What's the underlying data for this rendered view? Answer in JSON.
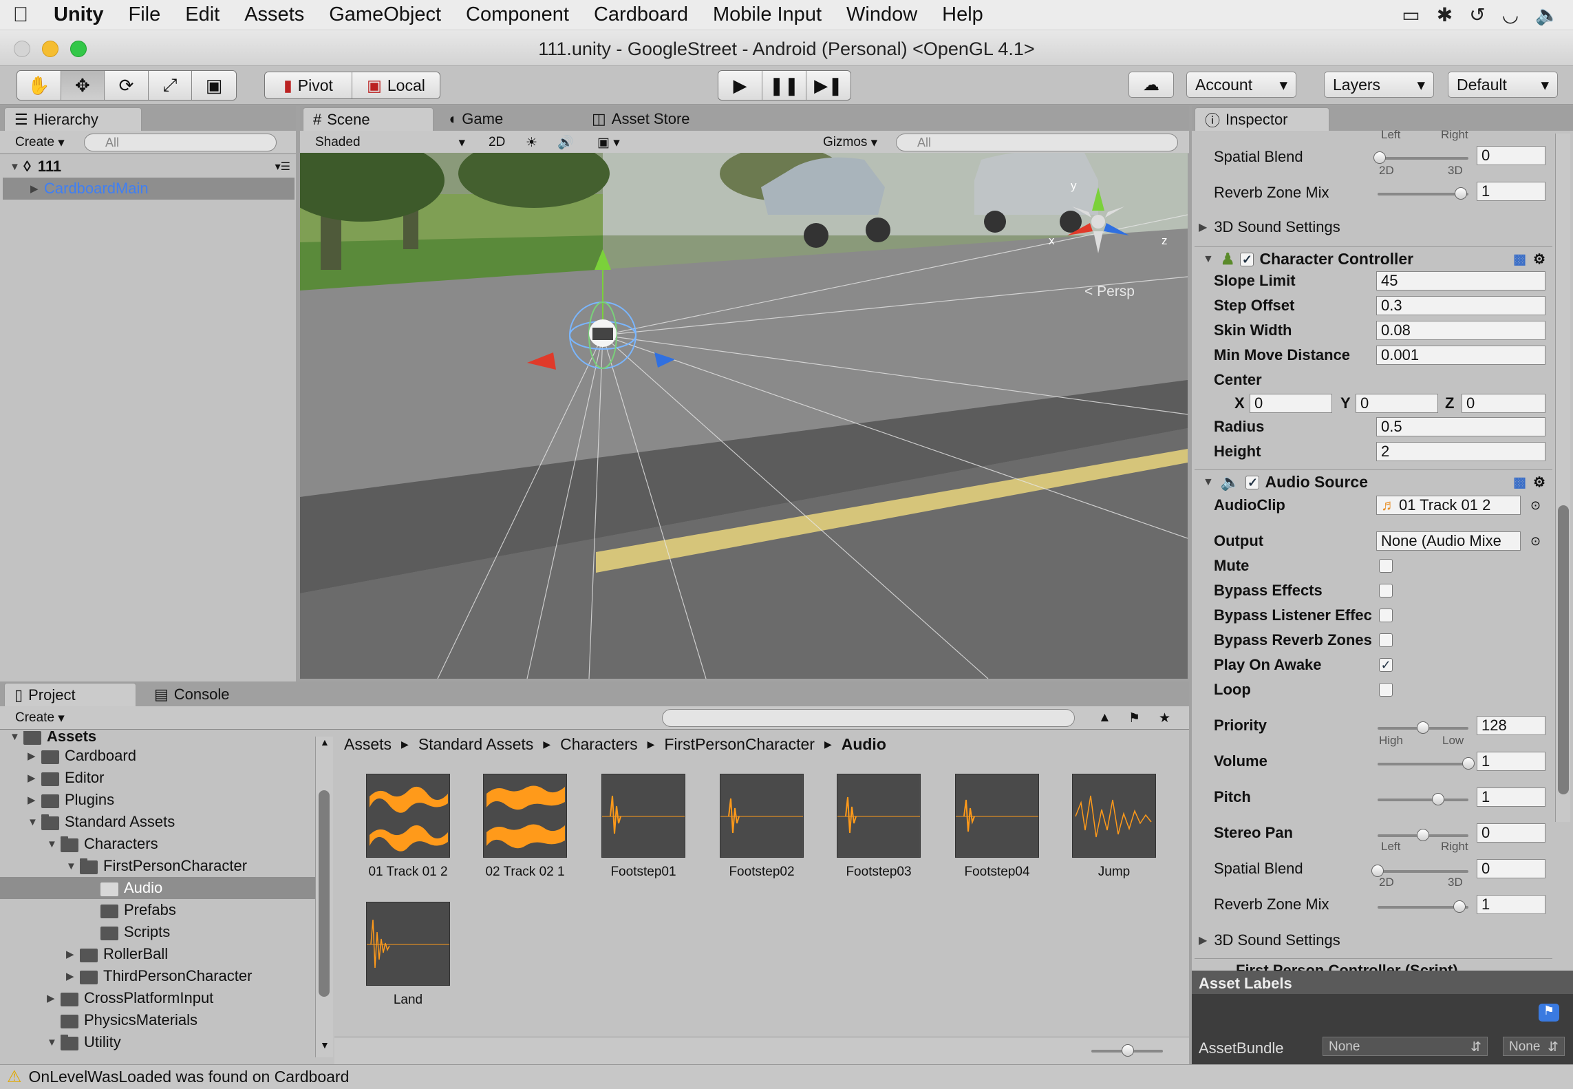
{
  "menubar": {
    "app": "Unity",
    "items": [
      "File",
      "Edit",
      "Assets",
      "GameObject",
      "Component",
      "Cardboard",
      "Mobile Input",
      "Window",
      "Help"
    ]
  },
  "window": {
    "title": "111.unity - GoogleStreet - Android (Personal) <OpenGL 4.1>"
  },
  "toolbar": {
    "pivot": "Pivot",
    "local": "Local",
    "account": "Account",
    "layers": "Layers",
    "layout": "Default"
  },
  "hierarchy": {
    "tab": "Hierarchy",
    "create": "Create",
    "search_placeholder": "All",
    "scene_name": "111",
    "items": [
      "CardboardMain"
    ]
  },
  "scene": {
    "tabs": [
      "Scene",
      "Game",
      "Asset Store"
    ],
    "shading": "Shaded",
    "mode_2d": "2D",
    "gizmos": "Gizmos",
    "search_placeholder": "All",
    "persp_label": "Persp",
    "axis_x": "x",
    "axis_y": "y",
    "axis_z": "z"
  },
  "project": {
    "tabs": [
      "Project",
      "Console"
    ],
    "create": "Create",
    "tree": {
      "root": "Assets",
      "cardboard": "Cardboard",
      "editor": "Editor",
      "plugins": "Plugins",
      "standard_assets": "Standard Assets",
      "characters": "Characters",
      "fpc": "FirstPersonCharacter",
      "audio": "Audio",
      "prefabs": "Prefabs",
      "scripts": "Scripts",
      "rollerball": "RollerBall",
      "tpc": "ThirdPersonCharacter",
      "cpi": "CrossPlatformInput",
      "physmat": "PhysicsMaterials",
      "utility": "Utility"
    },
    "breadcrumb": [
      "Assets",
      "Standard Assets",
      "Characters",
      "FirstPersonCharacter",
      "Audio"
    ],
    "assets": [
      "01 Track 01 2",
      "02 Track 02 1",
      "Footstep01",
      "Footstep02",
      "Footstep03",
      "Footstep04",
      "Jump",
      "Land"
    ]
  },
  "inspector": {
    "tab": "Inspector",
    "top": {
      "left": "Left",
      "right": "Right",
      "spatial_blend": "Spatial Blend",
      "spatial_blend_val": "0",
      "cap_2d": "2D",
      "cap_3d": "3D",
      "reverb": "Reverb Zone Mix",
      "reverb_val": "1",
      "sound3d": "3D Sound Settings"
    },
    "cc": {
      "title": "Character Controller",
      "slope_limit": "Slope Limit",
      "slope_limit_val": "45",
      "step_offset": "Step Offset",
      "step_offset_val": "0.3",
      "skin_width": "Skin Width",
      "skin_width_val": "0.08",
      "min_move": "Min Move Distance",
      "min_move_val": "0.001",
      "center": "Center",
      "x": "X",
      "x_val": "0",
      "y": "Y",
      "y_val": "0",
      "z": "Z",
      "z_val": "0",
      "radius": "Radius",
      "radius_val": "0.5",
      "height": "Height",
      "height_val": "2"
    },
    "audio": {
      "title": "Audio Source",
      "clip": "AudioClip",
      "clip_val": "01 Track 01 2",
      "output": "Output",
      "output_val": "None (Audio Mixe",
      "mute": "Mute",
      "bypass_effects": "Bypass Effects",
      "bypass_listener": "Bypass Listener Effec",
      "bypass_reverb": "Bypass Reverb Zones",
      "play_on_awake": "Play On Awake",
      "loop": "Loop",
      "play_on_awake_checked": true,
      "priority": "Priority",
      "priority_val": "128",
      "priority_level": 0.5,
      "high": "High",
      "low": "Low",
      "volume": "Volume",
      "volume_val": "1",
      "volume_level": 1.0,
      "pitch": "Pitch",
      "pitch_val": "1",
      "pitch_level": 0.67,
      "stereo_pan": "Stereo Pan",
      "stereo_pan_val": "0",
      "stereo_pan_level": 0.5,
      "left": "Left",
      "right": "Right",
      "spatial_blend": "Spatial Blend",
      "spatial_blend_val": "0",
      "spatial_blend_level": 0.0,
      "cap_2d": "2D",
      "cap_3d": "3D",
      "reverb": "Reverb Zone Mix",
      "reverb_val": "1",
      "reverb_level": 0.9,
      "sound3d": "3D Sound Settings"
    },
    "next_component": "First Person Controller (Script)",
    "asset_labels": "Asset Labels",
    "asset_bundle": "AssetBundle",
    "bundle_none": "None",
    "variant_none": "None"
  },
  "status": {
    "message": "OnLevelWasLoaded was found on Cardboard"
  },
  "colors": {
    "orange_waveform": "#ff9a1a",
    "selection": "#8e8e8e",
    "link_blue": "#3f7ff4"
  }
}
